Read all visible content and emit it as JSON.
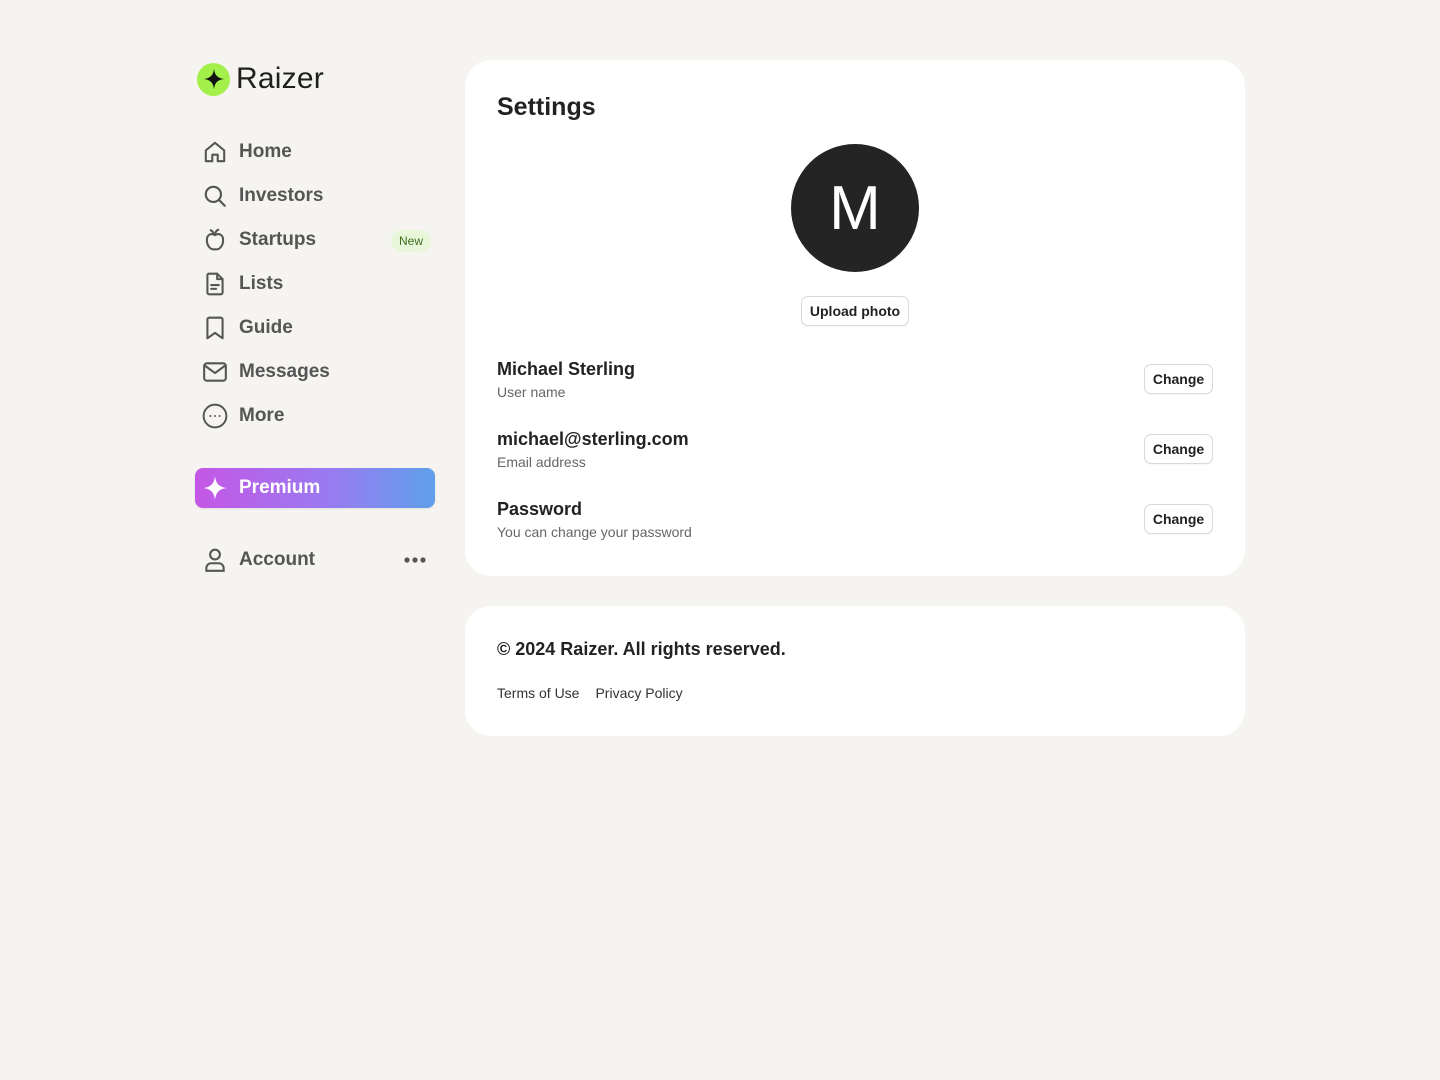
{
  "app": {
    "name": "Raizer",
    "accent_color": "#a3f04a"
  },
  "sidebar": {
    "items": [
      {
        "label": "Home",
        "icon": "home-icon"
      },
      {
        "label": "Investors",
        "icon": "search-icon"
      },
      {
        "label": "Startups",
        "icon": "apple-icon",
        "badge": "New"
      },
      {
        "label": "Lists",
        "icon": "document-icon"
      },
      {
        "label": "Guide",
        "icon": "bookmark-icon"
      },
      {
        "label": "Messages",
        "icon": "mail-icon"
      },
      {
        "label": "More",
        "icon": "more-circle-icon"
      }
    ],
    "premium": {
      "label": "Premium",
      "icon": "sparkle-icon"
    },
    "account": {
      "label": "Account",
      "icon": "user-icon"
    }
  },
  "settings": {
    "title": "Settings",
    "avatar_initial": "M",
    "upload_label": "Upload photo",
    "rows": [
      {
        "title": "Michael Sterling",
        "subtitle": "User name",
        "button": "Change"
      },
      {
        "title": "michael@sterling.com",
        "subtitle": "Email address",
        "button": "Change"
      },
      {
        "title": "Password",
        "subtitle": "You can change your password",
        "button": "Change"
      }
    ]
  },
  "footer": {
    "copyright": "© 2024 Raizer. All rights reserved.",
    "links": [
      "Terms of Use",
      "Privacy Policy"
    ]
  }
}
